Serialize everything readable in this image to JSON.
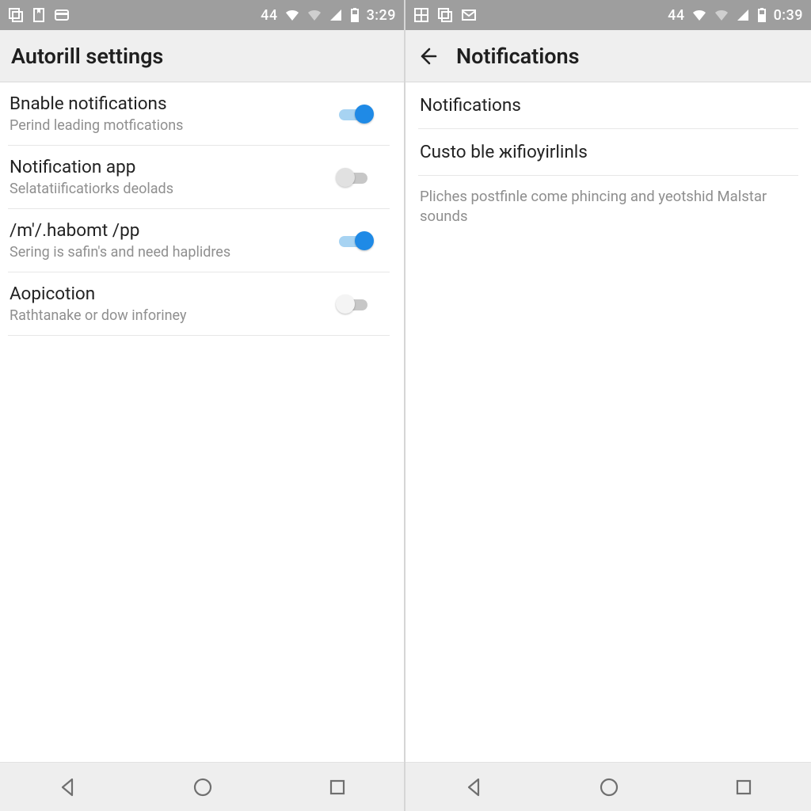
{
  "colors": {
    "accent": "#1f8ae6",
    "accent_track": "#a7d3f2",
    "statusbar_bg": "#9e9e9e"
  },
  "left": {
    "statusbar": {
      "num": "44",
      "time": "3:29"
    },
    "appbar": {
      "title": "Autorill settings"
    },
    "items": [
      {
        "title": "Bnable notifications",
        "subtitle": "Perind leading motfications",
        "state": "on"
      },
      {
        "title": "Notification app",
        "subtitle": "Selatatiificatiorks deolads",
        "state": "off"
      },
      {
        "title": "/m'/.habomt /pp",
        "subtitle": "Sering is safin's and need haplidres",
        "state": "on"
      },
      {
        "title": "Aopicotion",
        "subtitle": "Rathtanake or dow inforiney",
        "state": "off-light"
      }
    ]
  },
  "right": {
    "statusbar": {
      "num": "44",
      "time": "0:39"
    },
    "appbar": {
      "title": "Notifications"
    },
    "items": [
      {
        "title": "Notifications"
      },
      {
        "title": "Custo ble жifioyirlinls"
      }
    ],
    "description": "Pliches postfinle come phincing and yeotshid Malstar sounds"
  }
}
